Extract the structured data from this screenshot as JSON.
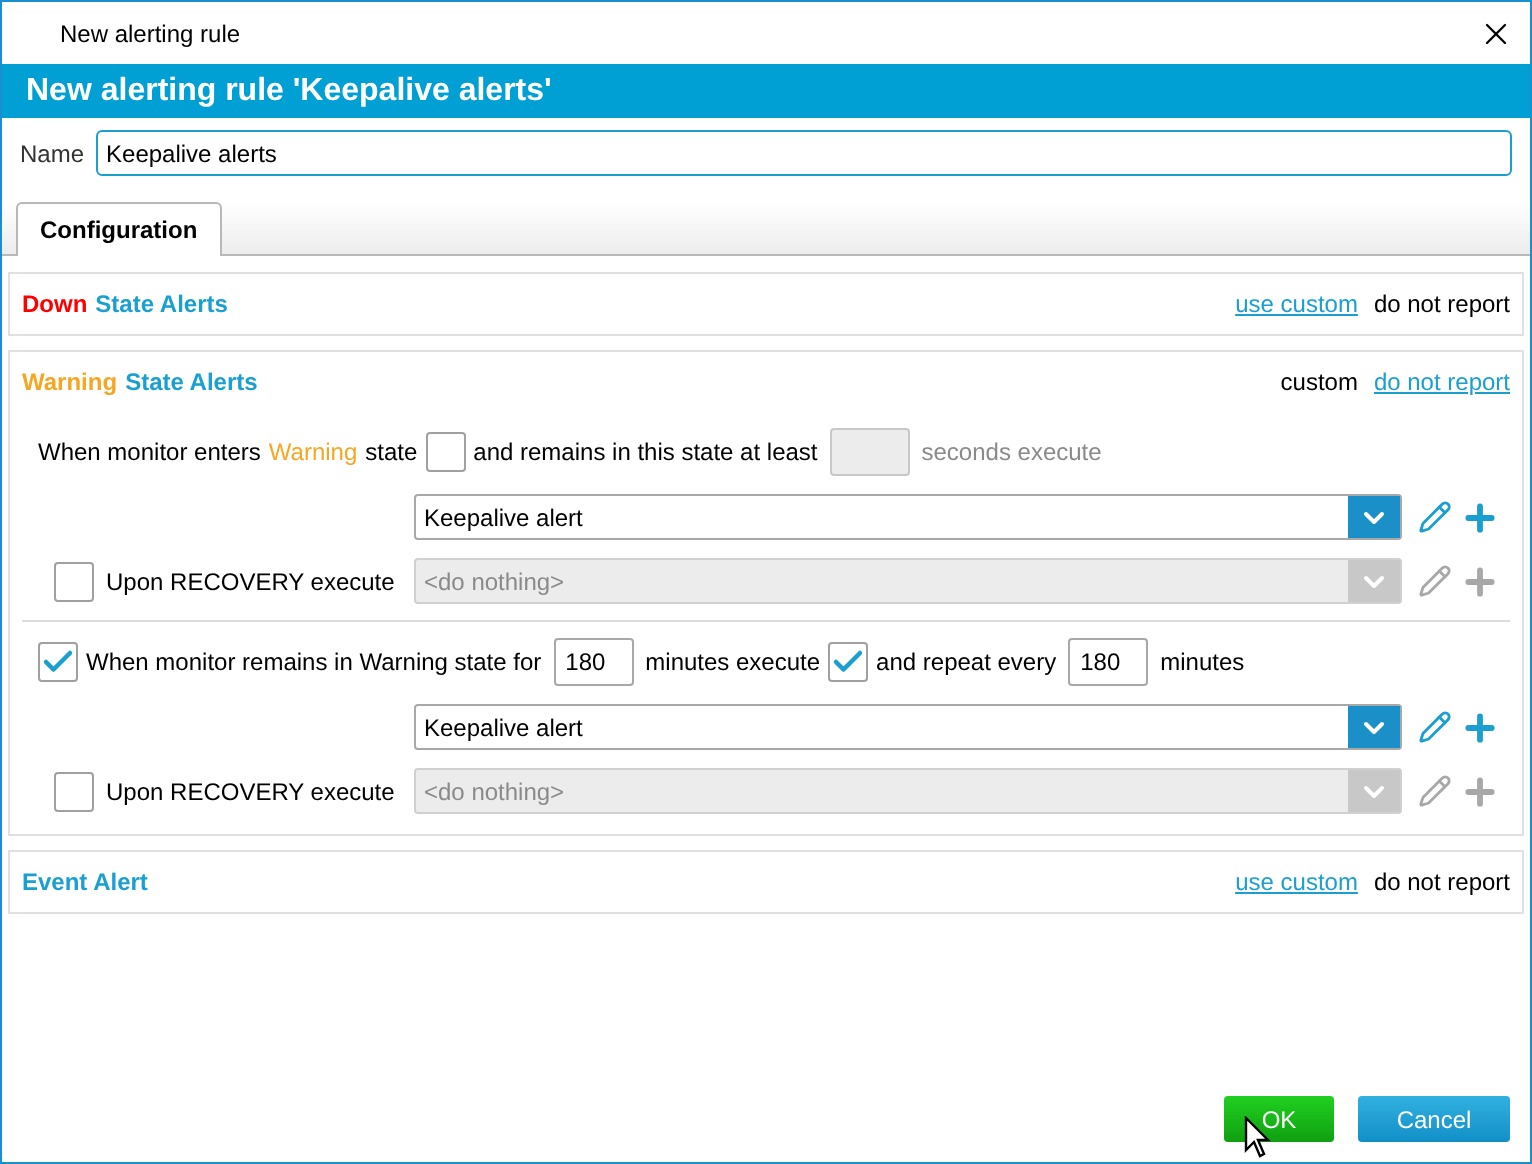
{
  "window": {
    "title": "New alerting rule"
  },
  "header": {
    "title": "New alerting rule 'Keepalive alerts'"
  },
  "name_field": {
    "label": "Name",
    "value": "Keepalive alerts"
  },
  "tabs": [
    {
      "label": "Configuration",
      "selected": true
    }
  ],
  "sections": [
    {
      "title_parts": [
        {
          "text": "Down",
          "color": "#ff0000"
        },
        {
          "text": "State Alerts",
          "color": "#1a9fd0"
        }
      ],
      "options": [
        {
          "label": "use custom",
          "selected": false
        },
        {
          "label": "do not report",
          "selected": true
        }
      ]
    },
    {
      "title_parts": [
        {
          "text": "Warning",
          "color": "#f5a623"
        },
        {
          "text": "State Alerts",
          "color": "#1a9fd0"
        }
      ],
      "options": [
        {
          "label": "custom",
          "selected": true
        },
        {
          "label": "do not report",
          "selected": false
        }
      ],
      "blocks": [
        {
          "condition": [
            {
              "kind": "text",
              "text": "When monitor enters"
            },
            {
              "kind": "text",
              "text": "Warning",
              "color": "#f5a623"
            },
            {
              "kind": "text",
              "text": "state"
            },
            {
              "kind": "checkbox",
              "checked": false
            },
            {
              "kind": "text",
              "text": "and remains in this state at least"
            },
            {
              "kind": "field",
              "disabled": true
            },
            {
              "kind": "text",
              "text": "seconds execute",
              "disabled": true
            }
          ],
          "action": {
            "value": "Keepalive alert",
            "disabled": false
          },
          "recovery": {
            "label": "Upon RECOVERY execute",
            "checked": false,
            "value": "<do nothing>",
            "disabled": true
          }
        },
        {
          "condition": [
            {
              "kind": "checkbox",
              "checked": true
            },
            {
              "kind": "text",
              "text": "When monitor remains in Warning state for"
            },
            {
              "kind": "field",
              "value": "180",
              "disabled": false
            },
            {
              "kind": "text",
              "text": "minutes execute"
            },
            {
              "kind": "checkbox",
              "checked": true
            },
            {
              "kind": "text",
              "text": "and repeat every"
            },
            {
              "kind": "field",
              "value": "180",
              "disabled": false
            },
            {
              "kind": "text",
              "text": "minutes"
            }
          ],
          "action": {
            "value": "Keepalive alert",
            "disabled": false
          },
          "recovery": {
            "label": "Upon RECOVERY execute",
            "checked": false,
            "value": "<do nothing>",
            "disabled": true
          }
        }
      ]
    },
    {
      "title_parts": [
        {
          "text": "Event Alert",
          "color": "#1a9fd0"
        }
      ],
      "options": [
        {
          "label": "use custom",
          "selected": false
        },
        {
          "label": "do not report",
          "selected": true
        }
      ]
    }
  ],
  "buttons": [
    {
      "label": "OK",
      "kind": "primary"
    },
    {
      "label": "Cancel",
      "kind": "secondary"
    }
  ]
}
